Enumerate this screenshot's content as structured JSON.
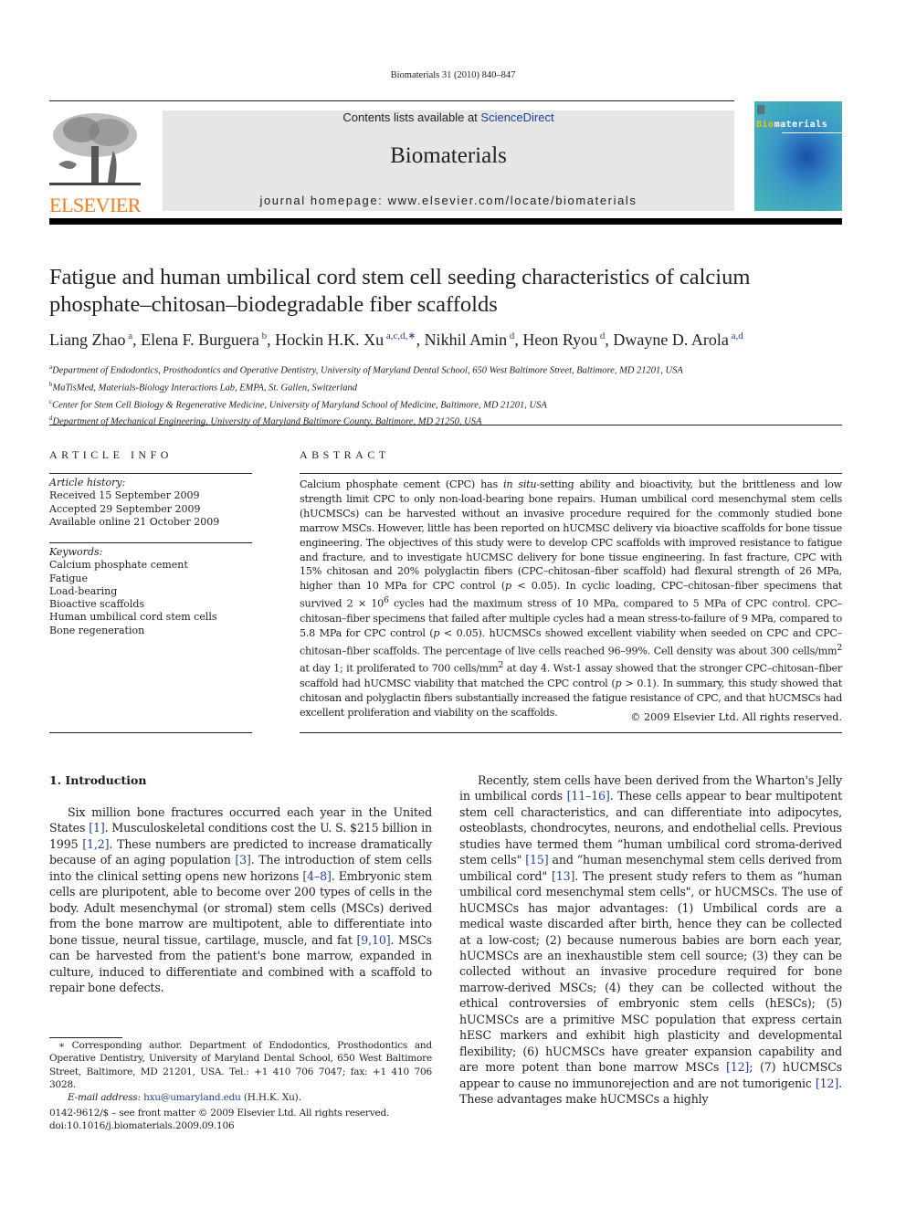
{
  "journal": {
    "citation": "Biomaterials 31 (2010) 840–847",
    "contents_prefix": "Contents lists available at ",
    "contents_link": "ScienceDirect",
    "name": "Biomaterials",
    "homepage": "journal homepage: www.elsevier.com/locate/biomaterials",
    "publisher_logo_text": "ELSEVIER",
    "cover_title_accent": "Bio",
    "cover_title_rest": "materials",
    "colors": {
      "publisher_orange": "#f07e1b",
      "link_blue": "#1f3f9c",
      "banner_gray": "#e6e6e6"
    }
  },
  "article": {
    "title": "Fatigue and human umbilical cord stem cell seeding characteristics of calcium phosphate–chitosan–biodegradable fiber scaffolds",
    "authors": [
      {
        "name": "Liang Zhao",
        "sup": "a"
      },
      {
        "name": "Elena F. Burguera",
        "sup": "b"
      },
      {
        "name": "Hockin H.K. Xu",
        "sup": "a,c,d,∗"
      },
      {
        "name": "Nikhil Amin",
        "sup": "d"
      },
      {
        "name": "Heon Ryou",
        "sup": "d"
      },
      {
        "name": "Dwayne D. Arola",
        "sup": "a,d"
      }
    ],
    "affiliations": [
      {
        "key": "a",
        "text": "Department of Endodontics, Prosthodontics and Operative Dentistry, University of Maryland Dental School, 650 West Baltimore Street, Baltimore, MD 21201, USA"
      },
      {
        "key": "b",
        "text": "MaTisMed, Materials-Biology Interactions Lab, EMPA, St. Gallen, Switzerland"
      },
      {
        "key": "c",
        "text": "Center for Stem Cell Biology & Regenerative Medicine, University of Maryland School of Medicine, Baltimore, MD 21201, USA"
      },
      {
        "key": "d",
        "text": "Department of Mechanical Engineering, University of Maryland Baltimore County, Baltimore, MD 21250, USA"
      }
    ]
  },
  "article_info": {
    "heading": "ARTICLE INFO",
    "history_label": "Article history:",
    "history": [
      "Received 15 September 2009",
      "Accepted 29 September 2009",
      "Available online 21 October 2009"
    ],
    "keywords_label": "Keywords:",
    "keywords": [
      "Calcium phosphate cement",
      "Fatigue",
      "Load-bearing",
      "Bioactive scaffolds",
      "Human umbilical cord stem cells",
      "Bone regeneration"
    ]
  },
  "abstract": {
    "heading": "ABSTRACT",
    "parts": [
      "Calcium phosphate cement (CPC) has ",
      "in situ",
      "-setting ability and bioactivity, but the brittleness and low strength limit CPC to only non-load-bearing bone repairs. Human umbilical cord mesenchymal stem cells (hUCMSCs) can be harvested without an invasive procedure required for the commonly studied bone marrow MSCs. However, little has been reported on hUCMSC delivery via bioactive scaffolds for bone tissue engineering. The objectives of this study were to develop CPC scaffolds with improved resistance to fatigue and fracture, and to investigate hUCMSC delivery for bone tissue engineering. In fast fracture, CPC with 15% chitosan and 20% polyglactin fibers (CPC–chitosan–fiber scaffold) had flexural strength of 26 MPa, higher than 10 MPa for CPC control (",
      "p",
      " < 0.05). In cyclic loading, CPC–chitosan–fiber specimens that survived 2 × 10",
      "6",
      " cycles had the maximum stress of 10 MPa, compared to 5 MPa of CPC control. CPC–chitosan–fiber specimens that failed after multiple cycles had a mean stress-to-failure of 9 MPa, compared to 5.8 MPa for CPC control (",
      "p",
      " < 0.05). hUCMSCs showed excellent viability when seeded on CPC and CPC–chitosan–fiber scaffolds. The percentage of live cells reached 96–99%. Cell density was about 300 cells/mm",
      "2",
      " at day 1; it proliferated to 700 cells/mm",
      "2",
      " at day 4. Wst-1 assay showed that the stronger CPC–chitosan–fiber scaffold had hUCMSC viability that matched the CPC control (",
      "p",
      " > 0.1). In summary, this study showed that chitosan and polyglactin fibers substantially increased the fatigue resistance of CPC, and that hUCMSCs had excellent proliferation and viability on the scaffolds."
    ],
    "copyright": "© 2009 Elsevier Ltd. All rights reserved."
  },
  "introduction": {
    "heading": "1.  Introduction",
    "left_paragraph": [
      "Six million bone fractures occurred each year in the United States ",
      "[1]",
      ". Musculoskeletal conditions cost the U. S. $215 billion in 1995 ",
      "[1,2]",
      ". These numbers are predicted to increase dramatically because of an aging population ",
      "[3]",
      ". The introduction of stem cells into the clinical setting opens new horizons ",
      "[4–8]",
      ". Embryonic stem cells are pluripotent, able to become over 200 types of cells in the body. Adult mesenchymal (or stromal) stem cells (MSCs) derived from the bone marrow are multipotent, able to differentiate into bone tissue, neural tissue, cartilage, muscle, and fat ",
      "[9,10]",
      ". MSCs can be harvested from the patient's bone marrow, expanded in culture, induced to differentiate and combined with a scaffold to repair bone defects."
    ],
    "right_paragraph": [
      "Recently, stem cells have been derived from the Wharton's Jelly in umbilical cords ",
      "[11–16]",
      ". These cells appear to bear multipotent stem cell characteristics, and can differentiate into adipocytes, osteoblasts, chondrocytes, neurons, and endothelial cells. Previous studies have termed them “human umbilical cord stroma-derived stem cells\" ",
      "[15]",
      " and “human mesenchymal stem cells derived from umbilical cord\" ",
      "[13]",
      ". The present study refers to them as “human umbilical cord mesenchymal stem cells\", or hUCMSCs. The use of hUCMSCs has major advantages: (1) Umbilical cords are a medical waste discarded after birth, hence they can be collected at a low-cost; (2) because numerous babies are born each year, hUCMSCs are an inexhaustible stem cell source; (3) they can be collected without an invasive procedure required for bone marrow-derived MSCs; (4) they can be collected without the ethical controversies of embryonic stem cells (hESCs); (5) hUCMSCs are a primitive MSC population that express certain hESC markers and exhibit high plasticity and developmental flexibility; (6) hUCMSCs have greater expansion capability and are more potent than bone marrow MSCs ",
      "[12]",
      "; (7) hUCMSCs appear to cause no immunorejection and are not tumorigenic ",
      "[12]",
      ". These advantages make hUCMSCs a highly"
    ]
  },
  "footnotes": {
    "corresponding": "∗ Corresponding author. Department of Endodontics, Prosthodontics and Operative Dentistry, University of Maryland Dental School, 650 West Baltimore Street, Baltimore, MD 21201, USA. Tel.: +1 410 706 7047; fax: +1 410 706 3028.",
    "email_label": "E-mail address:",
    "email": "hxu@umaryland.edu",
    "email_suffix": " (H.H.K. Xu).",
    "front_matter": "0142-9612/$ – see front matter © 2009 Elsevier Ltd. All rights reserved.",
    "doi": "doi:10.1016/j.biomaterials.2009.09.106"
  }
}
